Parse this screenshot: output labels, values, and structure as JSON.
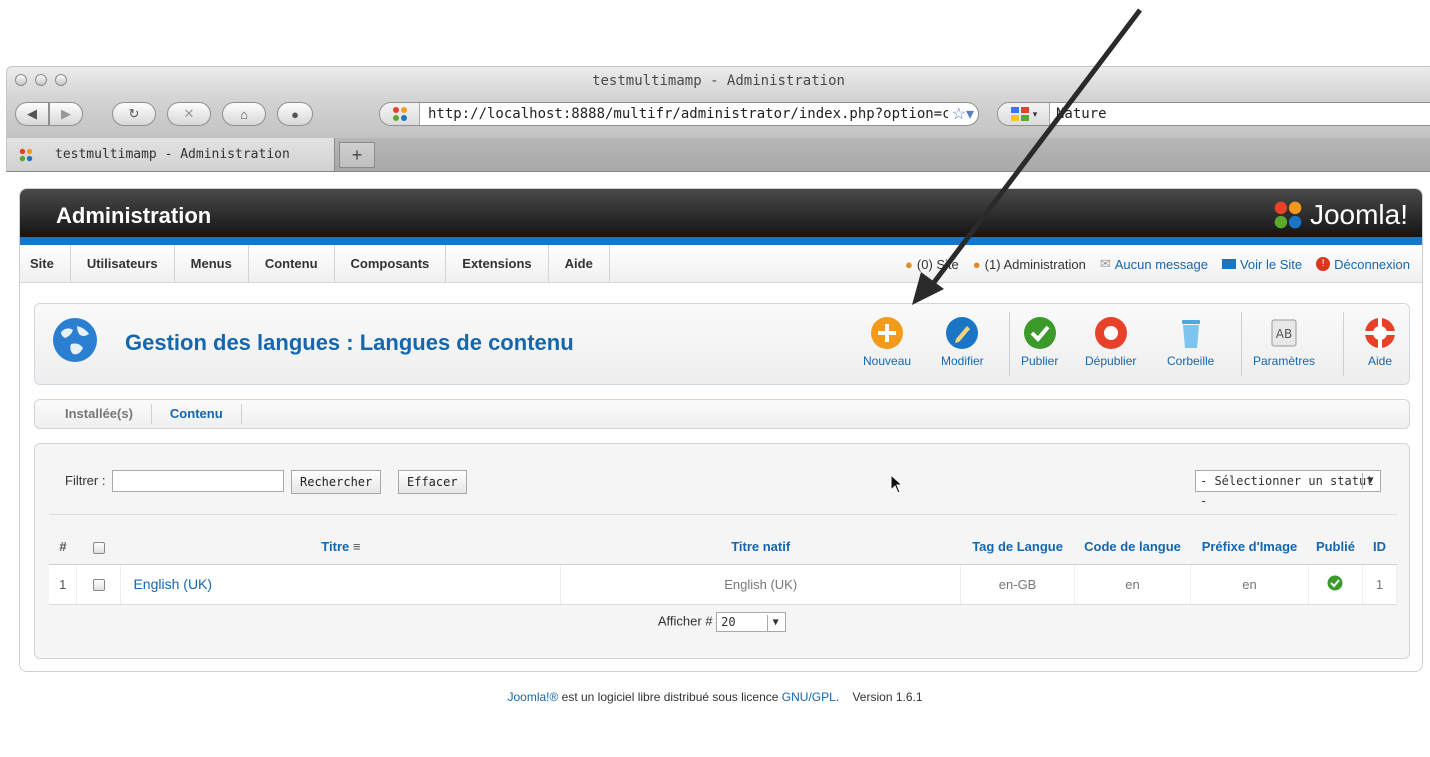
{
  "browser": {
    "window_title": "testmultimamp - Administration",
    "url": "http://localhost:8888/multifr/administrator/index.php?option=co",
    "search_text": "Nature",
    "tab_title": "testmultimamp - Administration",
    "new_tab_label": "+"
  },
  "admin": {
    "header_title": "Administration",
    "logo_text": "Joomla!",
    "menu": [
      "Site",
      "Utilisateurs",
      "Menus",
      "Contenu",
      "Composants",
      "Extensions",
      "Aide"
    ],
    "status": {
      "site": "(0) Site",
      "admin": "(1) Administration",
      "messages": "Aucun message",
      "view_site": "Voir le Site",
      "logout": "Déconnexion"
    },
    "page_title": "Gestion des langues : Langues de contenu",
    "tools": {
      "new": "Nouveau",
      "edit": "Modifier",
      "publish": "Publier",
      "unpublish": "Dépublier",
      "trash": "Corbeille",
      "params": "Paramètres",
      "help": "Aide"
    },
    "subtabs": {
      "installed": "Installée(s)",
      "content": "Contenu"
    },
    "filter": {
      "label": "Filtrer :",
      "value": "",
      "search_btn": "Rechercher",
      "clear_btn": "Effacer",
      "status_select": "- Sélectionner un statut -"
    },
    "table": {
      "headers": {
        "num": "#",
        "title": "Titre",
        "native": "Titre natif",
        "tag": "Tag de Langue",
        "code": "Code de langue",
        "image": "Préfixe d'Image",
        "published": "Publié",
        "id": "ID"
      },
      "rows": [
        {
          "num": "1",
          "title": "English (UK)",
          "native": "English (UK)",
          "tag": "en-GB",
          "code": "en",
          "image": "en",
          "published": true,
          "id": "1"
        }
      ]
    },
    "pagination": {
      "label": "Afficher #",
      "limit": "20"
    },
    "footer": {
      "brand": "Joomla!®",
      "text": " est un logiciel libre distribué sous licence ",
      "license": "GNU/GPL",
      "version": ".    Version 1.6.1"
    }
  },
  "colors": {
    "accent": "#1467ae",
    "header_bar": "#1a76c4",
    "new_orange": "#f39a1c",
    "publish_green": "#3c9a2a",
    "unpublish_red": "#e8412a"
  }
}
